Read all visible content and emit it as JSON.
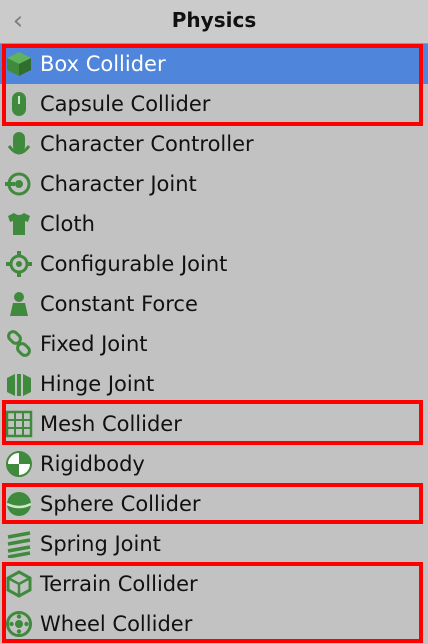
{
  "header": {
    "back_icon": "chevron-left-icon",
    "title": "Physics"
  },
  "items": [
    {
      "label": "Box Collider",
      "icon": "box-collider-icon",
      "selected": true,
      "highlighted": true
    },
    {
      "label": "Capsule Collider",
      "icon": "capsule-collider-icon",
      "selected": false,
      "highlighted": true
    },
    {
      "label": "Character Controller",
      "icon": "character-controller-icon",
      "selected": false,
      "highlighted": false
    },
    {
      "label": "Character Joint",
      "icon": "character-joint-icon",
      "selected": false,
      "highlighted": false
    },
    {
      "label": "Cloth",
      "icon": "cloth-icon",
      "selected": false,
      "highlighted": false
    },
    {
      "label": "Configurable Joint",
      "icon": "configurable-joint-icon",
      "selected": false,
      "highlighted": false
    },
    {
      "label": "Constant Force",
      "icon": "constant-force-icon",
      "selected": false,
      "highlighted": false
    },
    {
      "label": "Fixed Joint",
      "icon": "fixed-joint-icon",
      "selected": false,
      "highlighted": false
    },
    {
      "label": "Hinge Joint",
      "icon": "hinge-joint-icon",
      "selected": false,
      "highlighted": false
    },
    {
      "label": "Mesh Collider",
      "icon": "mesh-collider-icon",
      "selected": false,
      "highlighted": true
    },
    {
      "label": "Rigidbody",
      "icon": "rigidbody-icon",
      "selected": false,
      "highlighted": false
    },
    {
      "label": "Sphere Collider",
      "icon": "sphere-collider-icon",
      "selected": false,
      "highlighted": true
    },
    {
      "label": "Spring Joint",
      "icon": "spring-joint-icon",
      "selected": false,
      "highlighted": false
    },
    {
      "label": "Terrain Collider",
      "icon": "terrain-collider-icon",
      "selected": false,
      "highlighted": true
    },
    {
      "label": "Wheel Collider",
      "icon": "wheel-collider-icon",
      "selected": false,
      "highlighted": true
    }
  ],
  "colors": {
    "background": "#c2c2c2",
    "selected": "#4f86db",
    "icon_green": "#3f8a3c",
    "highlight_border": "#ff0000"
  }
}
